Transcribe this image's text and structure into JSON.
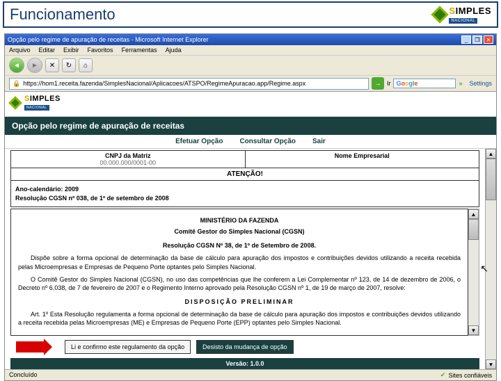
{
  "slide": {
    "title": "Funcionamento"
  },
  "logo": {
    "brand": "IMPLES",
    "s": "S",
    "sub": "NACIONAL"
  },
  "browser": {
    "title": "Opção pelo regime de apuração de receitas - Microsoft Internet Explorer",
    "menu": {
      "arquivo": "Arquivo",
      "editar": "Editar",
      "exibir": "Exibir",
      "favoritos": "Favoritos",
      "ferramentas": "Ferramentas",
      "ajuda": "Ajuda"
    },
    "url": "https://hom1.receita.fazenda/SimplesNacional/Aplicacoes/ATSPO/RegimeApuracao.app/Regime.aspx",
    "go_label": "Ir",
    "search": "Google",
    "settings": "Settings",
    "status_left": "Concluído",
    "status_right": "Sites confiáveis"
  },
  "page": {
    "heading": "Opção pelo regime de apuração de receitas",
    "menu": {
      "efetuar": "Efetuar Opção",
      "consultar": "Consultar Opção",
      "sair": "Sair"
    },
    "form": {
      "cnpj_label": "CNPJ da Matriz",
      "cnpj_value": "00.000.000/0001-00",
      "nome_label": "Nome Empresarial",
      "nome_value": " "
    },
    "attention": "ATENÇÃO!",
    "res_year": "Ano-calendário: 2009",
    "res_ref": "Resolução CGSN nº 038, de 1º de setembro de 2008",
    "doc": {
      "ministry": "MINISTÉRIO DA FAZENDA",
      "committee": "Comitê Gestor do Simples Nacional (CGSN)",
      "res_title": "Resolução CGSN Nº 38, de 1º de Setembro de 2008.",
      "ementa": "Dispõe sobre a forma opcional de determinação da base de cálculo para apuração dos impostos e contribuições devidos utilizando a receita recebida pelas Microempresas e Empresas de Pequeno Porte optantes pelo Simples Nacional.",
      "preambulo": "O Comitê Gestor do Simples Nacional (CGSN), no uso das competências que lhe conferem a Lei Complementar nº 123, de 14 de dezembro de 2006, o Decreto nº 6.038, de 7 de fevereiro de 2007 e o Regimento Interno aprovado pela Resolução CGSN nº 1, de 19 de março de 2007, resolve:",
      "section": "DISPOSIÇÃO PRELIMINAR",
      "art1": "Art. 1º Esta Resolução regulamenta a forma opcional de determinação da base de cálculo para apuração dos impostos e contribuições devidos utilizando a receita recebida pelas Microempresas (ME) e Empresas de Pequeno Porte (EPP) optantes pelo Simples Nacional."
    },
    "actions": {
      "confirm": "Li e confirmo este regulamento da opção",
      "reject": "Desisto da mudança de opção"
    },
    "version": "Versão: 1.0.0"
  }
}
